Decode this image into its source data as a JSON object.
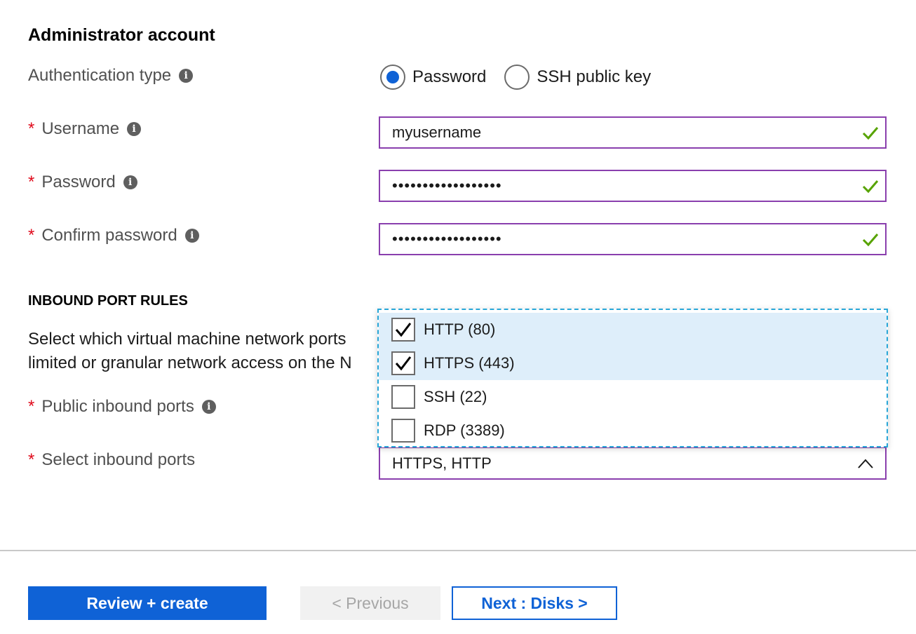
{
  "section": {
    "title": "Administrator account"
  },
  "auth": {
    "label": "Authentication type",
    "options": [
      "Password",
      "SSH public key"
    ],
    "selected": "Password"
  },
  "username": {
    "label": "Username",
    "value": "myusername"
  },
  "password": {
    "label": "Password",
    "value": "••••••••••••••••••"
  },
  "confirm_password": {
    "label": "Confirm password",
    "value": "••••••••••••••••••"
  },
  "inbound": {
    "heading": "INBOUND PORT RULES",
    "description_line1": "Select which virtual machine network ports",
    "description_line2": "limited or granular network access on the N",
    "public_ports_label": "Public inbound ports",
    "select_ports_label": "Select inbound ports",
    "select_ports_value": "HTTPS, HTTP",
    "options": [
      {
        "label": "HTTP (80)",
        "checked": true
      },
      {
        "label": "HTTPS (443)",
        "checked": true
      },
      {
        "label": "SSH (22)",
        "checked": false
      },
      {
        "label": "RDP (3389)",
        "checked": false
      }
    ]
  },
  "footer": {
    "review_label": "Review + create",
    "previous_label": "< Previous",
    "next_label": "Next : Disks >"
  },
  "colors": {
    "accent": "#0f62d6",
    "field_border": "#8a3fae",
    "valid_check": "#57a300",
    "required": "#e00b1c",
    "selected_row": "#deeefa"
  },
  "icons": {
    "info": "info-icon",
    "valid": "checkmark-icon",
    "chevron": "chevron-up-icon"
  }
}
